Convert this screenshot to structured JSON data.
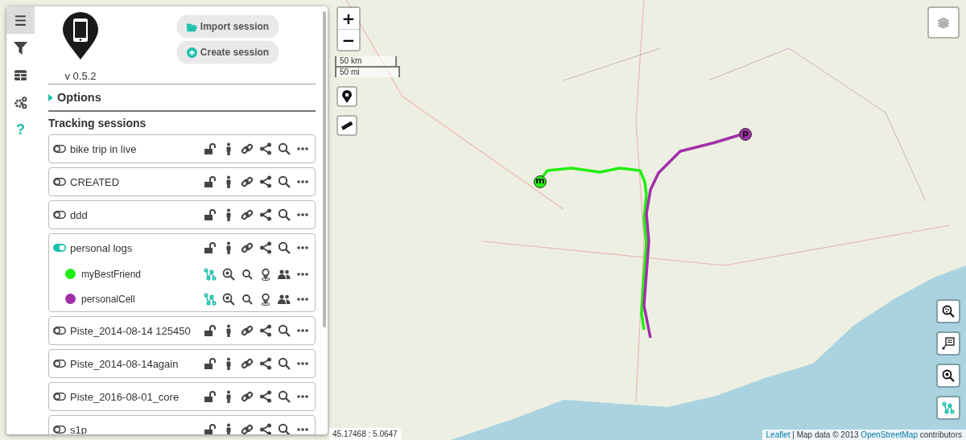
{
  "sidebar": {
    "tabs": [
      {
        "kind": "menu",
        "selected": true
      },
      {
        "kind": "filter",
        "selected": false
      },
      {
        "kind": "table",
        "selected": false
      },
      {
        "kind": "settings",
        "selected": false
      },
      {
        "kind": "help",
        "glyph": "?",
        "selected": false
      }
    ],
    "version": "v 0.5.2",
    "buttons": [
      {
        "kind": "import",
        "label": "Import session"
      },
      {
        "kind": "create",
        "label": "Create session"
      }
    ],
    "options": {
      "label": "Options",
      "expanded": false
    },
    "sessions_title": "Tracking sessions",
    "sessions": [
      {
        "name": "bike trip in live",
        "enabled": false
      },
      {
        "name": "CREATED",
        "enabled": false
      },
      {
        "name": "ddd",
        "enabled": false
      },
      {
        "name": "personal logs",
        "enabled": true,
        "devices": [
          {
            "name": "myBestFriend",
            "color": "#22ee11"
          },
          {
            "name": "personalCell",
            "color": "#a030a8"
          }
        ]
      },
      {
        "name": "Piste_2014-08-14 125450",
        "enabled": false
      },
      {
        "name": "Piste_2014-08-14again",
        "enabled": false
      },
      {
        "name": "Piste_2016-08-01_core",
        "enabled": false
      },
      {
        "name": "s1p",
        "enabled": false
      }
    ]
  },
  "map": {
    "zoom_in": "+",
    "zoom_out": "−",
    "scale": [
      "50 km",
      "50 mi"
    ],
    "markers": [
      {
        "label": "m",
        "color": "#22ee11"
      },
      {
        "label": "p",
        "color": "#a030a8"
      }
    ],
    "coordinates": "45.17468 : 5.0647",
    "attribution": {
      "link_1": "Leaflet",
      "text_1": " | Map data © 2013 ",
      "link_2": "OpenStreetMap",
      "text_2": " contributors"
    }
  }
}
